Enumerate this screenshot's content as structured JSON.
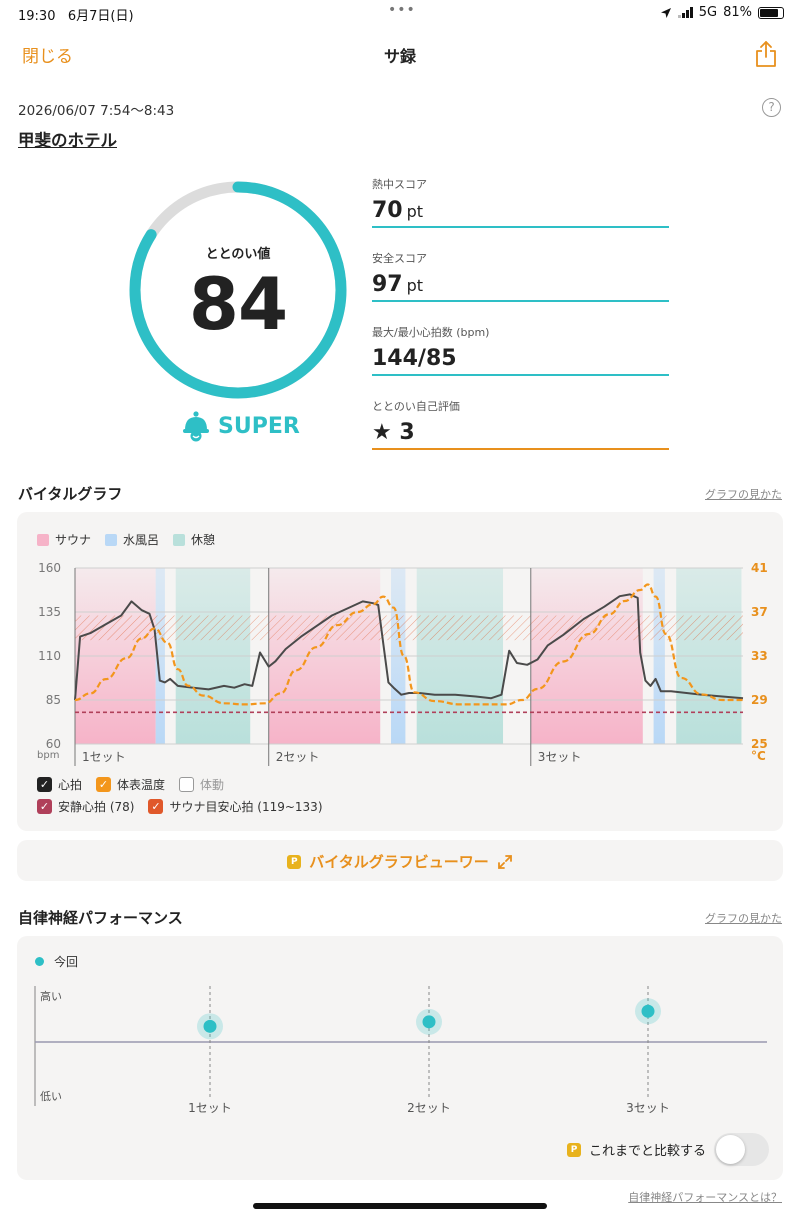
{
  "status_bar": {
    "time": "19:30",
    "date": "6月7日(日)",
    "dots": "•••",
    "network": "5G",
    "battery": "81%"
  },
  "nav": {
    "close_label": "閉じる",
    "title": "サ録",
    "share_icon": "share-icon"
  },
  "session": {
    "datetime": "2026/06/07 7:54〜8:43",
    "place": "甲斐のホテル",
    "help_label": "?"
  },
  "totonoi": {
    "label": "ととのい値",
    "value": "84",
    "progress": 0.84,
    "rank": "SUPER",
    "accent_color": "#2ebfc6"
  },
  "scores": [
    {
      "label": "熱中スコア",
      "value": "70",
      "unit": "pt"
    },
    {
      "label": "安全スコア",
      "value": "97",
      "unit": "pt"
    },
    {
      "label": "最大/最小心拍数 (bpm)",
      "value": "144/85",
      "unit": ""
    },
    {
      "label": "ととのい自己評価",
      "value": "★ 3",
      "unit": ""
    }
  ],
  "vital": {
    "title": "バイタルグラフ",
    "help_link": "グラフの見かた",
    "legend_top": [
      {
        "label": "サウナ",
        "color": "#f6b3c8"
      },
      {
        "label": "水風呂",
        "color": "#b9d8f6"
      },
      {
        "label": "休憩",
        "color": "#b9e0db"
      }
    ],
    "legend_bottom": [
      {
        "label": "心拍",
        "checked": true,
        "color": "#222222"
      },
      {
        "label": "体表温度",
        "checked": true,
        "color": "#f3961c"
      },
      {
        "label": "体動",
        "checked": false,
        "color": "#aaaaaa"
      },
      {
        "label": "安静心拍 (78)",
        "checked": true,
        "color": "#b0405a"
      },
      {
        "label": "サウナ目安心拍 (119~133)",
        "checked": true,
        "color": "#e0582a"
      }
    ],
    "viewer_label": "バイタルグラフビューワー",
    "viewer_badge": "P"
  },
  "chart_data": [
    {
      "type": "line",
      "title": "バイタルグラフ",
      "y_left": {
        "label": "bpm",
        "ticks": [
          160,
          135,
          110,
          85,
          60
        ],
        "range": [
          60,
          160
        ]
      },
      "y_right": {
        "label": "°C",
        "ticks": [
          41,
          37,
          33,
          29,
          25
        ],
        "range": [
          25,
          41
        ]
      },
      "x_labels": [
        "1セット",
        "2セット",
        "3セット"
      ],
      "resting_hr": 78,
      "target_hr_range": [
        119,
        133
      ],
      "phases": [
        {
          "type": "sauna",
          "set": 1,
          "start": 0.0,
          "end": 0.157
        },
        {
          "type": "water",
          "set": 1,
          "start": 0.157,
          "end": 0.175
        },
        {
          "type": "rest",
          "set": 1,
          "start": 0.196,
          "end": 0.341
        },
        {
          "type": "sauna",
          "set": 2,
          "start": 0.377,
          "end": 0.594
        },
        {
          "type": "water",
          "set": 2,
          "start": 0.615,
          "end": 0.643
        },
        {
          "type": "rest",
          "set": 2,
          "start": 0.665,
          "end": 0.833
        },
        {
          "type": "sauna",
          "set": 3,
          "start": 0.887,
          "end": 1.105
        },
        {
          "type": "water",
          "set": 3,
          "start": 1.126,
          "end": 1.148
        },
        {
          "type": "rest",
          "set": 3,
          "start": 1.17,
          "end": 1.297
        }
      ],
      "series": [
        {
          "name": "心拍",
          "x": [
            0,
            0.01,
            0.03,
            0.06,
            0.09,
            0.11,
            0.13,
            0.145,
            0.155,
            0.165,
            0.175,
            0.185,
            0.2,
            0.23,
            0.26,
            0.29,
            0.31,
            0.33,
            0.345,
            0.36,
            0.377,
            0.39,
            0.41,
            0.44,
            0.47,
            0.5,
            0.53,
            0.56,
            0.58,
            0.59,
            0.6,
            0.61,
            0.62,
            0.635,
            0.65,
            0.67,
            0.7,
            0.74,
            0.78,
            0.81,
            0.83,
            0.845,
            0.86,
            0.88,
            0.9,
            0.92,
            0.95,
            0.99,
            1.03,
            1.06,
            1.08,
            1.095,
            1.1,
            1.11,
            1.12,
            1.13,
            1.14,
            1.16,
            1.19,
            1.22,
            1.26,
            1.3
          ],
          "values": [
            85,
            121,
            123,
            128,
            133,
            141,
            136,
            134,
            125,
            96,
            95,
            97,
            93,
            92,
            91,
            93,
            92,
            94,
            93,
            112,
            104,
            107,
            114,
            121,
            127,
            133,
            137,
            141,
            140,
            139,
            117,
            95,
            92,
            88,
            89,
            89,
            88,
            88,
            87,
            86,
            88,
            113,
            106,
            105,
            108,
            116,
            122,
            131,
            138,
            144,
            145,
            143,
            112,
            96,
            93,
            97,
            90,
            90,
            89,
            88,
            87,
            86
          ]
        },
        {
          "name": "体表温度",
          "x": [
            0,
            0.03,
            0.06,
            0.1,
            0.13,
            0.155,
            0.18,
            0.2,
            0.22,
            0.25,
            0.29,
            0.33,
            0.37,
            0.4,
            0.43,
            0.47,
            0.51,
            0.55,
            0.58,
            0.6,
            0.62,
            0.64,
            0.66,
            0.7,
            0.75,
            0.8,
            0.84,
            0.87,
            0.9,
            0.95,
            1.0,
            1.04,
            1.07,
            1.1,
            1.115,
            1.13,
            1.15,
            1.18,
            1.22,
            1.26,
            1.3
          ],
          "values": [
            29,
            29.6,
            30.9,
            32.8,
            34.6,
            35.5,
            34.2,
            31.8,
            30.3,
            29.4,
            28.7,
            28.6,
            28.7,
            29.6,
            31.7,
            33.8,
            35.8,
            37.0,
            37.7,
            38.4,
            37.4,
            33.0,
            29.7,
            28.9,
            28.6,
            28.6,
            28.6,
            29.0,
            30.0,
            32.5,
            35.0,
            36.8,
            38.0,
            39.0,
            39.5,
            38.4,
            35.0,
            31.0,
            29.5,
            29.0,
            29.0
          ]
        }
      ]
    },
    {
      "type": "scatter",
      "title": "自律神経パフォーマンス",
      "y_labels": [
        "高い",
        "低い"
      ],
      "x_labels": [
        "1セット",
        "2セット",
        "3セット"
      ],
      "series": [
        {
          "name": "今回",
          "values": [
            0.28,
            0.36,
            0.55
          ]
        }
      ]
    }
  ],
  "autonomic": {
    "title": "自律神経パフォーマンス",
    "help_link": "グラフの見かた",
    "legend": "今回",
    "high": "高い",
    "low": "低い",
    "set_labels": [
      "1セット",
      "2セット",
      "3セット"
    ],
    "compare_label": "これまでと比較する",
    "compare_badge": "P",
    "compare_on": false,
    "footer_link": "自律神経パフォーマンスとは？"
  }
}
